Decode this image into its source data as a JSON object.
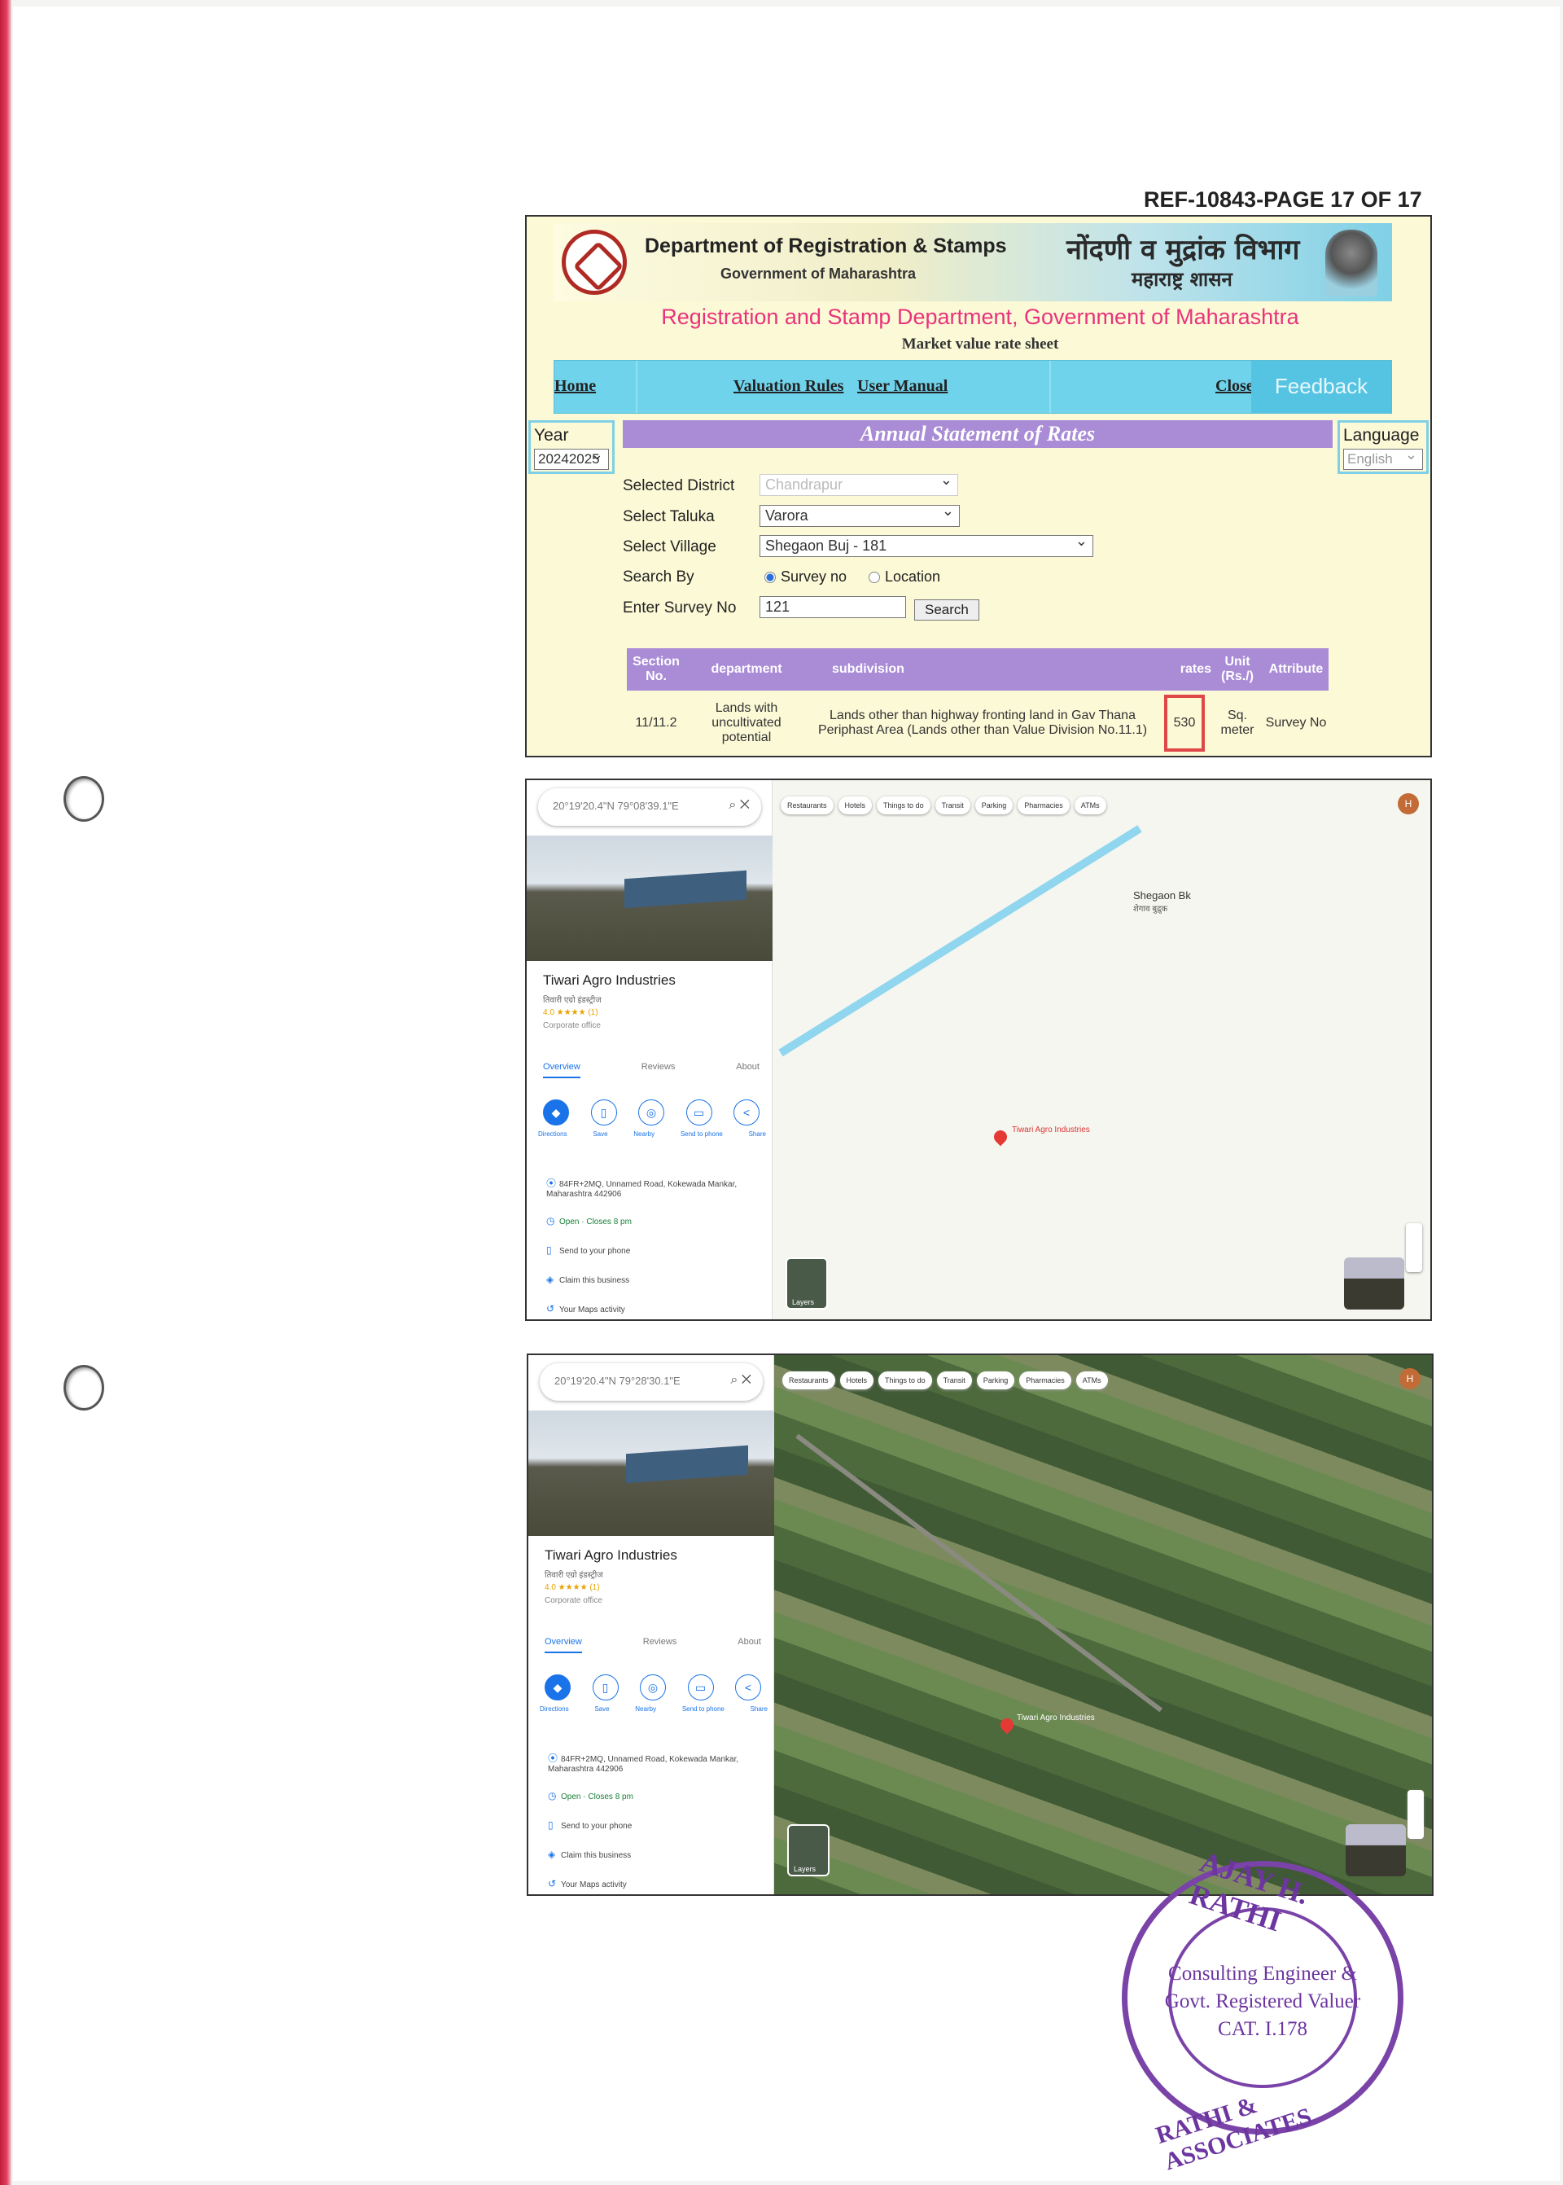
{
  "ref": "REF-10843-PAGE 17 OF 17",
  "portal": {
    "dept_en": "Department of Registration & Stamps",
    "gov_en": "Government of Maharashtra",
    "dept_mr": "नोंदणी व मुद्रांक विभाग",
    "gov_mr": "महाराष्ट्र शासन",
    "title": "Registration and Stamp Department, Government of Maharashtra",
    "subtitle": "Market value rate sheet",
    "nav": {
      "home": "Home",
      "valuation": "Valuation Rules",
      "manual": "User Manual",
      "close": "Close",
      "feedback": "Feedback"
    },
    "year_label": "Year",
    "year_value": "20242025",
    "language_label": "Language",
    "language_value": "English",
    "banner": "Annual Statement of Rates",
    "form": {
      "district_label": "Selected District",
      "district_value": "Chandrapur",
      "taluka_label": "Select Taluka",
      "taluka_value": "Varora",
      "village_label": "Select Village",
      "village_value": "Shegaon Buj - 181",
      "searchby_label": "Search By",
      "opt_survey": "Survey no",
      "opt_location": "Location",
      "survey_label": "Enter Survey No",
      "survey_value": "121",
      "search_button": "Search"
    },
    "table": {
      "headers": [
        "Section No.",
        "department",
        "subdivision",
        "rates",
        "Unit (Rs./)",
        "Attribute"
      ],
      "row": {
        "section": "11/11.2",
        "department": "Lands with uncultivated potential",
        "subdivision": "Lands other than highway fronting land in Gav Thana Periphast Area (Lands other than Value Division No.11.1)",
        "rate": "530",
        "unit": "Sq. meter",
        "attribute": "Survey No"
      }
    }
  },
  "maps": {
    "search_map": "20°19'20.4\"N 79°08'39.1\"E",
    "search_sat": "20°19'20.4\"N 79°28'30.1\"E",
    "place_name": "Tiwari Agro Industries",
    "place_local": "तिवारी एग्रो इंडस्ट्रीज",
    "rating": "4.0 ★★★★ (1)",
    "category": "Corporate office",
    "tabs": [
      "Overview",
      "Reviews",
      "About"
    ],
    "actions": [
      "Directions",
      "Save",
      "Nearby",
      "Send to phone",
      "Share"
    ],
    "address": "84FR+2MQ, Unnamed Road, Kokewada Mankar, Maharashtra 442906",
    "hours": "Open · Closes 8 pm",
    "send": "Send to your phone",
    "claim": "Claim this business",
    "activity": "Your Maps activity",
    "chips": [
      "Restaurants",
      "Hotels",
      "Things to do",
      "Transit",
      "Parking",
      "Pharmacies",
      "ATMs"
    ],
    "labels": {
      "village": "Shegaon Bk",
      "village_local": "शेगाव बुद्रुक",
      "pin": "Tiwari Agro Industries",
      "layers": "Layers",
      "avatar": "H"
    }
  },
  "stamp": {
    "top": "AJAY H. RATHI",
    "bottom": "RATHI & ASSOCIATES",
    "line1": "Consulting Engineer &",
    "line2": "Govt. Registered Valuer",
    "line3": "CAT. I.178"
  }
}
